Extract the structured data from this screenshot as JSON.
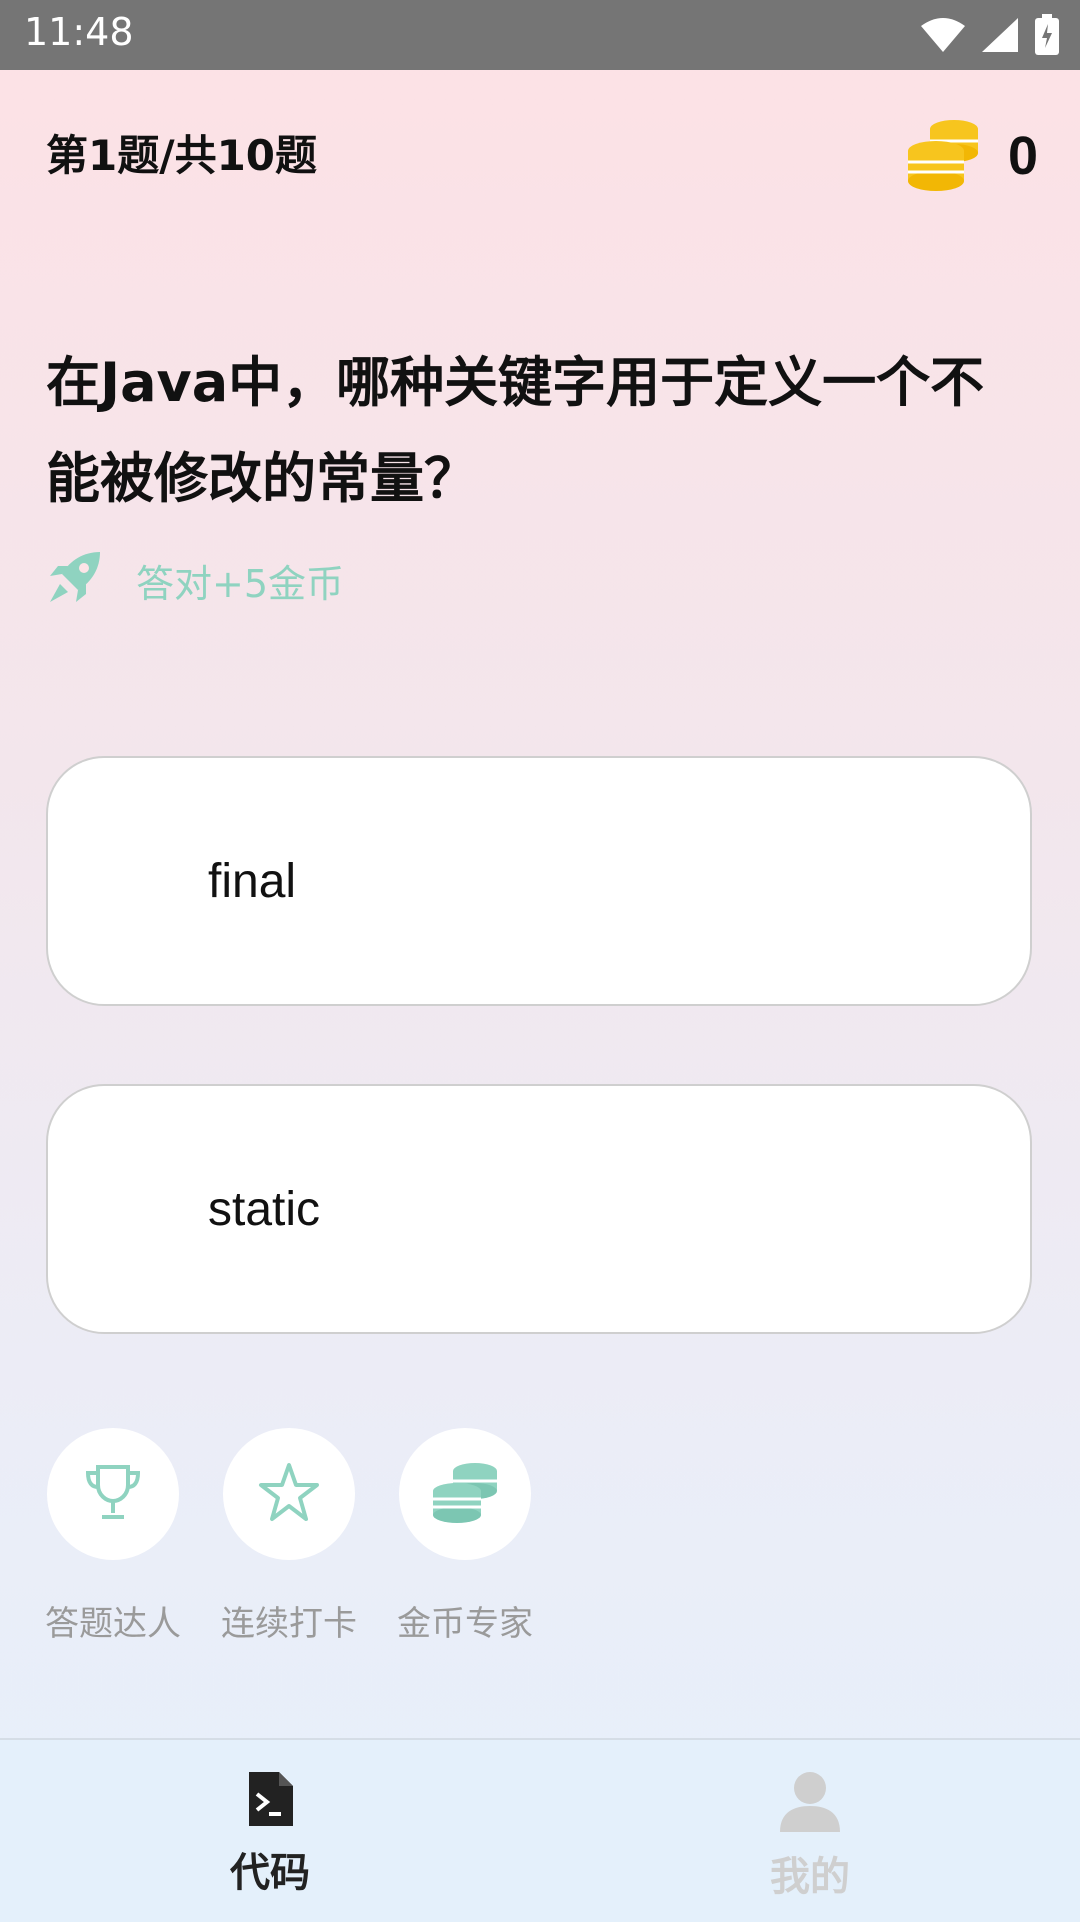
{
  "status_bar": {
    "time": "11:48",
    "icons": [
      "wifi-icon",
      "signal-icon",
      "battery-icon"
    ]
  },
  "header": {
    "progress": "第1题/共10题",
    "coins": "0",
    "coin_icon": "coins-icon"
  },
  "question": {
    "text": "在Java中，哪种关键字用于定义一个不能被修改的常量？"
  },
  "reward": {
    "icon": "rocket-icon",
    "text": "答对+5金币"
  },
  "options": [
    {
      "label": "final"
    },
    {
      "label": "static"
    }
  ],
  "badges": [
    {
      "icon": "trophy-icon",
      "label": "答题达人"
    },
    {
      "icon": "star-icon",
      "label": "连续打卡"
    },
    {
      "icon": "coins-icon",
      "label": "金币专家"
    }
  ],
  "nav": [
    {
      "icon": "code-file-icon",
      "label": "代码",
      "active": true
    },
    {
      "icon": "user-icon",
      "label": "我的",
      "active": false
    }
  ],
  "colors": {
    "accent": "#8fd3c0",
    "coin": "#f7c51e",
    "active_nav": "#222222",
    "inactive_nav": "#cfcfcf"
  }
}
